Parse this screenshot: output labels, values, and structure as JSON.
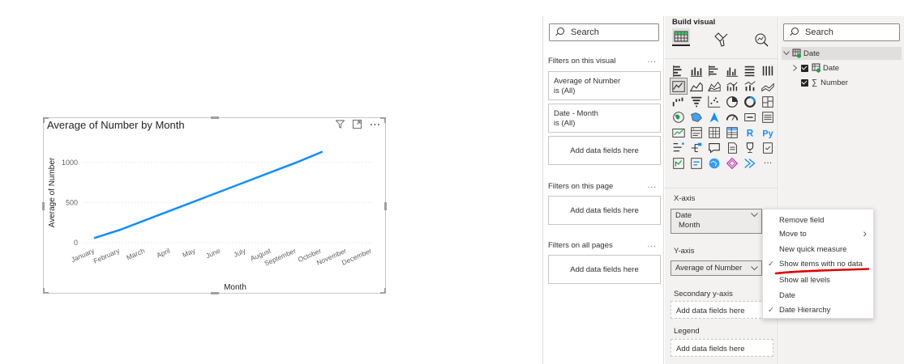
{
  "visual": {
    "title": "Average of Number by Month",
    "header_icons": [
      "filter-icon",
      "focus-mode-icon",
      "more-options-icon"
    ]
  },
  "chart_data": {
    "type": "line",
    "title": "Average of Number by Month",
    "xlabel": "Month",
    "ylabel": "Average of Number",
    "categories": [
      "January",
      "February",
      "March",
      "April",
      "May",
      "June",
      "July",
      "August",
      "September",
      "October",
      "November",
      "December"
    ],
    "series": [
      {
        "values": [
          60,
          160,
          280,
          400,
          520,
          640,
          760,
          880,
          1000,
          1130
        ]
      }
    ],
    "y_ticks": [
      "0",
      "500",
      "1000"
    ],
    "ylim": [
      0,
      1250
    ],
    "grid": true,
    "line_color": "#118dff"
  },
  "filters": {
    "search_placeholder": "Search",
    "on_visual": "Filters on this visual",
    "card1_title": "Average of Number",
    "card1_sub": "is (All)",
    "card2_title": "Date - Month",
    "card2_sub": "is (All)",
    "add_fields": "Add data fields here",
    "on_page": "Filters on this page",
    "on_all": "Filters on all pages",
    "dots": "..."
  },
  "build": {
    "title": "Build visual",
    "x_axis": "X-axis",
    "x_field": "Date",
    "x_sub": "Month",
    "y_axis": "Y-axis",
    "y_field": "Average of Number",
    "secondary": "Secondary y-axis",
    "legend": "Legend",
    "add_fields": "Add data fields here",
    "r_label": "R",
    "py_label": "Py",
    "more": "···"
  },
  "data_pane": {
    "search_placeholder": "Search",
    "table": "Date",
    "hierarchy": "Date",
    "measure": "Number",
    "sigma": "∑"
  },
  "context_menu": {
    "items": [
      "Remove field",
      "Move to",
      "New quick measure",
      "Show items with no data",
      "Show all levels",
      "Date",
      "Date Hierarchy"
    ],
    "check": "✓",
    "chevron": "›"
  },
  "colors": {
    "accent": "#118dff",
    "annotation": "#e00000",
    "report_green": "#1aa34a"
  }
}
